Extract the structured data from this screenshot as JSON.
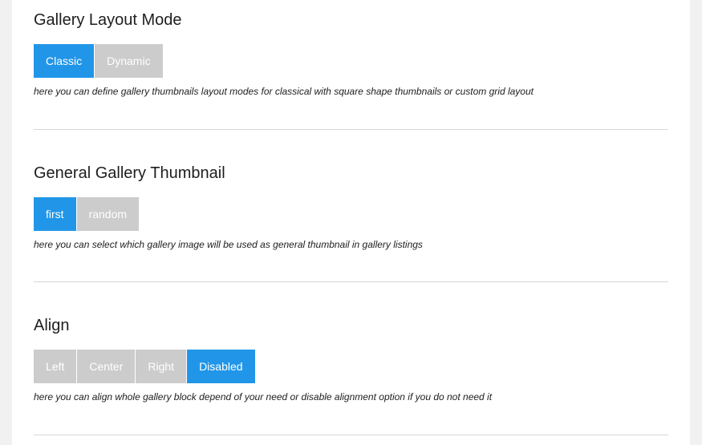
{
  "sections": [
    {
      "title": "Gallery Layout Mode",
      "options": [
        "Classic",
        "Dynamic"
      ],
      "active_option": "Classic",
      "description": "here you can define gallery thumbnails layout modes for classical with square shape thumbnails or custom grid layout"
    },
    {
      "title": "General Gallery Thumbnail",
      "options": [
        "first",
        "random"
      ],
      "active_option": "first",
      "description": "here you can select which gallery image will be used as general thumbnail in gallery listings"
    },
    {
      "title": "Align",
      "options": [
        "Left",
        "Center",
        "Right",
        "Disabled"
      ],
      "active_option": "Disabled",
      "description": "here you can align whole gallery block depend of your need or disable alignment option if you do not need it"
    }
  ],
  "colors": {
    "active": "#2196e8",
    "inactive": "#cccccc"
  }
}
